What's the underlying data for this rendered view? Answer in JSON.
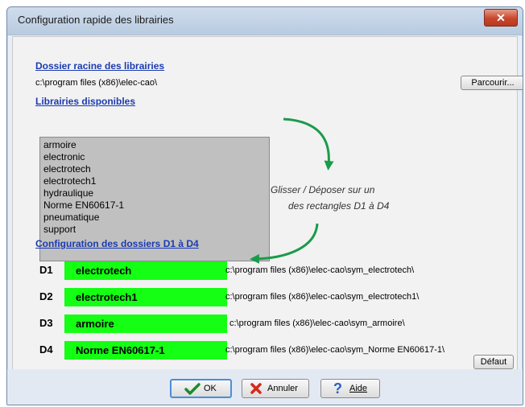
{
  "window": {
    "title": "Configuration rapide des librairies",
    "close_glyph": "✕"
  },
  "root": {
    "heading": "Dossier racine des librairies",
    "path": "c:\\program files (x86)\\elec-cao\\",
    "browse_label": "Parcourir..."
  },
  "libraries": {
    "heading": "Librairies disponibles",
    "items": [
      "armoire",
      "electronic",
      "electrotech",
      "electrotech1",
      "hydraulique",
      "Norme EN60617-1",
      "pneumatique",
      "support"
    ]
  },
  "hint": {
    "line1": "Glisser / Déposer sur un",
    "line2": "des rectangles D1 à D4"
  },
  "folders": {
    "heading": "Configuration des dossiers D1 à D4",
    "slots": [
      {
        "label": "D1",
        "name": "electrotech",
        "path": "c:\\program files (x86)\\elec-cao\\sym_electrotech\\"
      },
      {
        "label": "D2",
        "name": "electrotech1",
        "path": "c:\\program files (x86)\\elec-cao\\sym_electrotech1\\"
      },
      {
        "label": "D3",
        "name": "armoire",
        "path": "c:\\program files (x86)\\elec-cao\\sym_armoire\\"
      },
      {
        "label": "D4",
        "name": "Norme EN60617-1",
        "path": "c:\\program files (x86)\\elec-cao\\sym_Norme EN60617-1\\"
      }
    ],
    "default_label": "Défaut"
  },
  "buttons": {
    "ok_label": "OK",
    "cancel_label": "Annuler",
    "help_label": "Aide"
  },
  "colors": {
    "slot_fill": "#14ff14",
    "arrow": "#1a9b4a",
    "heading": "#1b3bb0",
    "listbox": "#c0c0c0"
  },
  "icons": {
    "ok": "checkmark-icon",
    "cancel": "x-icon",
    "help": "question-mark-icon"
  }
}
